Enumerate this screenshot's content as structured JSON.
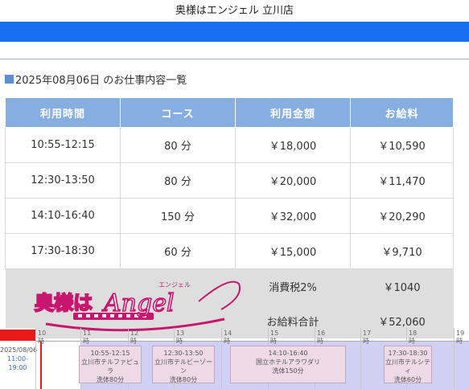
{
  "header": {
    "title": "奥様はエンジェル 立川店"
  },
  "section": {
    "heading": "2025年08月06日 のお仕事内容一覧"
  },
  "table": {
    "columns": [
      "利用時間",
      "コース",
      "利用金額",
      "お給料"
    ],
    "rows": [
      [
        "10:55-12:15",
        "80 分",
        "￥18,000",
        "￥10,590"
      ],
      [
        "12:30-13:50",
        "80 分",
        "￥20,000",
        "￥11,470"
      ],
      [
        "14:10-16:40",
        "150 分",
        "￥32,000",
        "￥20,290"
      ],
      [
        "17:30-18:30",
        "60 分",
        "￥15,000",
        "￥9,710"
      ]
    ],
    "tax_label": "消費税2%",
    "tax_value": "￥1040",
    "total_label": "お給料合計",
    "total_value": "￥52,060"
  },
  "logo": {
    "text_main": "奥様は",
    "text_script": "Angel",
    "text_ruby": "エンジェル"
  },
  "timeline": {
    "date": "2025/08/06",
    "shift": "11:00-19:00",
    "hours": [
      "10時",
      "11時",
      "12時",
      "13時",
      "14時",
      "15時",
      "16時",
      "17時",
      "18時",
      "19時"
    ],
    "blocks": [
      {
        "time": "10:55-12:15",
        "place": "立川市テルファピュラ",
        "course": "洗体80分"
      },
      {
        "time": "12:30-13:50",
        "place": "立川市テルビーゾーン",
        "course": "洗体80分"
      },
      {
        "time": "14:10-16:40",
        "place": "国立ホテルアラワダリ",
        "course": "洗体150分"
      },
      {
        "time": "17:30-18:30",
        "place": "立川市テルシティ",
        "course": "洗体60分"
      }
    ]
  },
  "colors": {
    "accent": "#1a6ef2",
    "table_header": "#86aee0",
    "band": "#cfd0f3",
    "red": "#e81919"
  }
}
